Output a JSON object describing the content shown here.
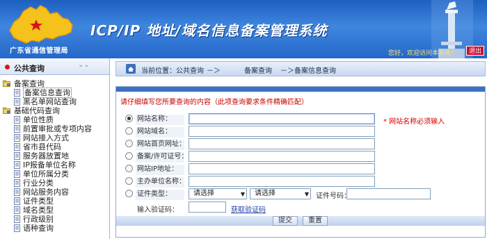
{
  "header": {
    "org_name": "广东省通信管理局",
    "system_title": "ICP/IP 地址/域名信息备案管理系统",
    "welcome": "您好，欢迎访问本系统！",
    "logout_label": "退出"
  },
  "sidebar": {
    "title": "公共查询",
    "tree": [
      {
        "label": "备案查询",
        "level": 0,
        "icon": "folder-open-icon"
      },
      {
        "label": "备案信息查询",
        "level": 1,
        "icon": "document-icon",
        "selected": true
      },
      {
        "label": "黑名单网站查询",
        "level": 1,
        "icon": "document-icon"
      },
      {
        "label": "基础代码查询",
        "level": 0,
        "icon": "folder-open-icon"
      },
      {
        "label": "单位性质",
        "level": 1,
        "icon": "document-icon"
      },
      {
        "label": "前置审批或专项内容",
        "level": 1,
        "icon": "document-icon"
      },
      {
        "label": "网站接入方式",
        "level": 1,
        "icon": "document-icon"
      },
      {
        "label": "省市县代码",
        "level": 1,
        "icon": "document-icon"
      },
      {
        "label": "服务器放置地",
        "level": 1,
        "icon": "document-icon"
      },
      {
        "label": "IP报备单位名称",
        "level": 1,
        "icon": "document-icon"
      },
      {
        "label": "单位所属分类",
        "level": 1,
        "icon": "document-icon"
      },
      {
        "label": "行业分类",
        "level": 1,
        "icon": "document-icon"
      },
      {
        "label": "网站服务内容",
        "level": 1,
        "icon": "document-icon"
      },
      {
        "label": "证件类型",
        "level": 1,
        "icon": "document-icon"
      },
      {
        "label": "域名类型",
        "level": 1,
        "icon": "document-icon"
      },
      {
        "label": "行政级别",
        "level": 1,
        "icon": "document-icon"
      },
      {
        "label": "语种查询",
        "level": 1,
        "icon": "document-icon"
      }
    ]
  },
  "breadcrumb": {
    "current_label": "当前位置：公共查询",
    "sep1": "－＞",
    "item2": "备案查询",
    "sep2": "－＞",
    "item3": "备案信息查询"
  },
  "form": {
    "hint": "请仔细填写您所要查询的内容（此项查询要求条件精确匹配）",
    "fields": [
      {
        "label": "网站名称：",
        "value": "",
        "checked": true
      },
      {
        "label": "网站域名：",
        "value": "",
        "checked": false
      },
      {
        "label": "网站首页网址：",
        "value": "",
        "checked": false
      },
      {
        "label": "备案/许可证号：",
        "value": "",
        "checked": false
      },
      {
        "label": "网站IP地址：",
        "value": "",
        "checked": false
      },
      {
        "label": "主办单位名称：",
        "value": "",
        "checked": false
      }
    ],
    "required_note": "* 网站名称必须输入",
    "cert_type_label": "证件类型：",
    "cert_select1": "请选择",
    "cert_select2": "请选择",
    "cert_no_label": "证件号码：",
    "cert_no_value": "",
    "verify_label": "输入验证码：",
    "verify_value": "",
    "captcha_link": "获取验证码",
    "submit_label": "提交",
    "reset_label": "重置"
  },
  "colors": {
    "banner_blue": "#2468c9",
    "accent_red": "#c40000",
    "form_header_blue": "#3b70c3"
  }
}
